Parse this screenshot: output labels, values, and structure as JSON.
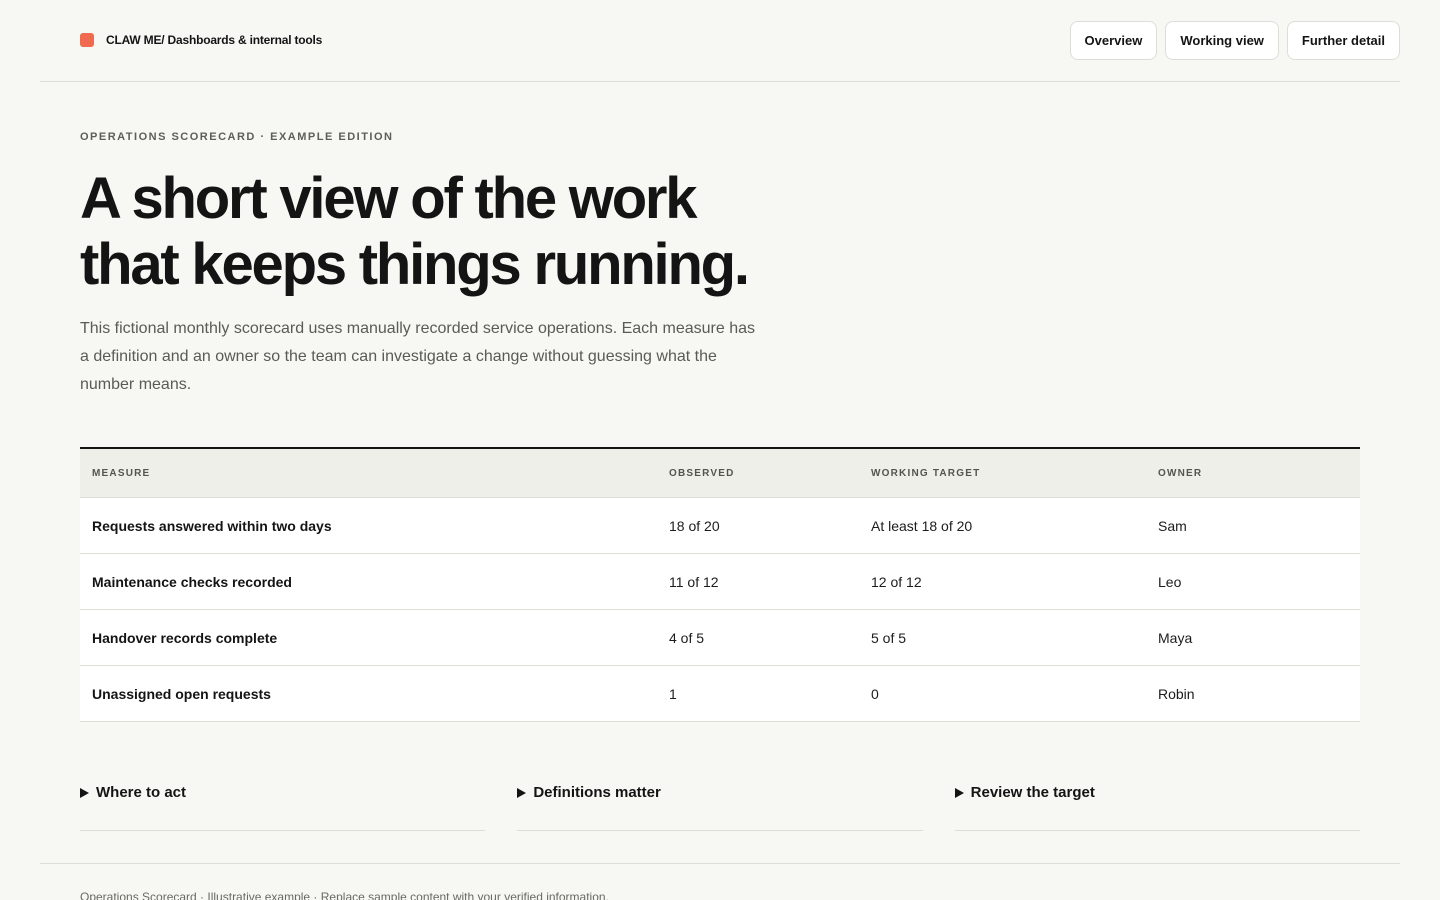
{
  "header": {
    "brand": "CLAW ME/ Dashboards & internal tools",
    "nav": [
      "Overview",
      "Working view",
      "Further detail"
    ]
  },
  "hero": {
    "eyebrow": "OPERATIONS SCORECARD · EXAMPLE EDITION",
    "title_line1": "A short view of the work",
    "title_line2": "that keeps things running.",
    "lede": "This fictional monthly scorecard uses manually recorded service operations. Each measure has a definition and an owner so the team can investigate a change without guessing what the number means."
  },
  "table": {
    "headers": [
      "MEASURE",
      "OBSERVED",
      "WORKING TARGET",
      "OWNER"
    ],
    "rows": [
      [
        "Requests answered within two days",
        "18 of 20",
        "At least 18 of 20",
        "Sam"
      ],
      [
        "Maintenance checks recorded",
        "11 of 12",
        "12 of 12",
        "Leo"
      ],
      [
        "Handover records complete",
        "4 of 5",
        "5 of 5",
        "Maya"
      ],
      [
        "Unassigned open requests",
        "1",
        "0",
        "Robin"
      ]
    ]
  },
  "details": [
    "Where to act",
    "Definitions matter",
    "Review the target"
  ],
  "footer": {
    "text": "Operations Scorecard · Illustrative example · Replace sample content with your verified information."
  },
  "colors": {
    "background": "#f7f7f3",
    "brand_accent": "#ef6a4f",
    "text": "#141414"
  }
}
